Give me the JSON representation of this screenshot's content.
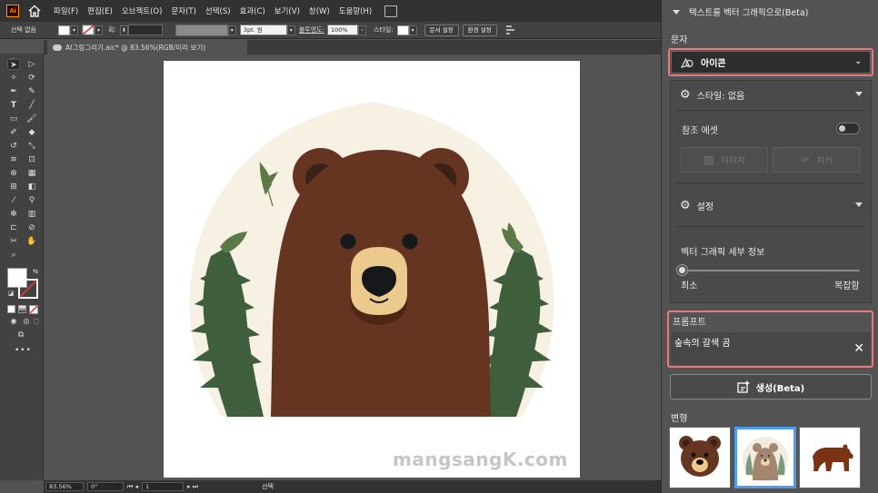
{
  "app": {
    "logo": "Ai",
    "menus": [
      "파일(F)",
      "편집(E)",
      "오브젝트(O)",
      "문자(T)",
      "선택(S)",
      "효과(C)",
      "보기(V)",
      "창(W)",
      "도움말(H)"
    ]
  },
  "control_bar": {
    "selection_label": "선택 없음",
    "stroke_label": "획:",
    "stroke_style": "3pt. 원",
    "opacity_label": "불투명도:",
    "opacity_value": "100%",
    "style_label": "스타일:",
    "doc_setup": "문서 설정",
    "preferences": "환경 설정"
  },
  "document_tab": {
    "title": "AI그림그리기.aic* @ 83.56%(RGB/미리 보기)"
  },
  "status_bar": {
    "zoom": "83.56%",
    "rotation": "0°",
    "artboard_index": "1",
    "tool_name": "선택"
  },
  "canvas": {
    "watermark": "mangsangK.com",
    "colors": {
      "bear": "#653521",
      "bear_dark": "#4e2616",
      "ear_inner": "#3a2219",
      "muzzle": "#ecc98c",
      "nose": "#15191c",
      "background_circle": "#f7f1e3",
      "leaf": "#3f5e3c",
      "leaf_light": "#5b7a45"
    }
  },
  "panel": {
    "title": "텍스트를 벡터 그래픽으로(Beta)",
    "type_label": "문자",
    "type_value": "아이콘",
    "style_section": "스타일: 없음",
    "reference_label": "참조 에셋",
    "image_btn": "이미지",
    "picker_btn": "피커",
    "settings_section": "설정",
    "detail_label": "벡터 그래픽 세부 정보",
    "detail_min": "최소",
    "detail_max": "복잡함",
    "detail_level": 0,
    "prompt_label": "프롬프트",
    "prompt_value": "숲속의 갈색 곰",
    "generate_btn": "생성(Beta)",
    "variants_label": "변형",
    "selected_variant": 2
  }
}
